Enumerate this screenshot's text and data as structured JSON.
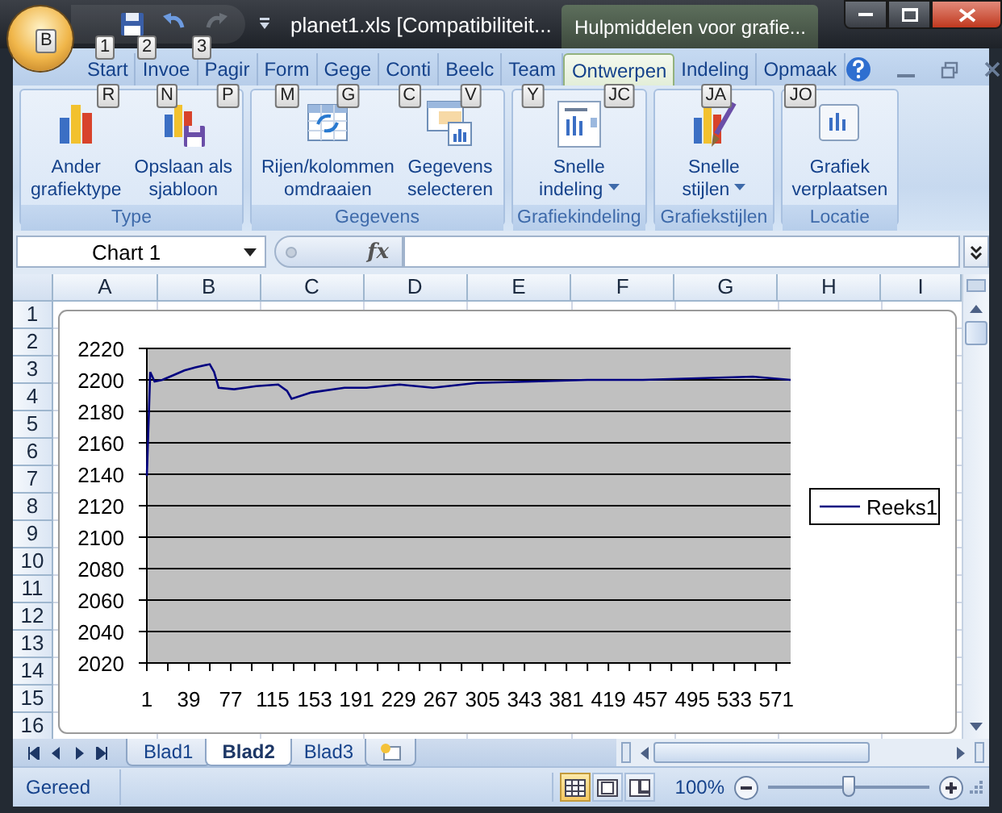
{
  "window": {
    "title": "planet1.xls  [Compatibiliteit...",
    "context_title": "Hulpmiddelen voor grafie..."
  },
  "office_button": {
    "keytip": "B"
  },
  "quick_access": [
    {
      "keytip": "1",
      "disabled": false
    },
    {
      "keytip": "2",
      "disabled": false
    },
    {
      "keytip": "3",
      "disabled": true
    }
  ],
  "ribbon_tabs": [
    {
      "label": "Start",
      "keytip": "R",
      "selected": false
    },
    {
      "label": "Invoe",
      "keytip": "N",
      "selected": false
    },
    {
      "label": "Pagir",
      "keytip": "P",
      "selected": false
    },
    {
      "label": "Form",
      "keytip": "M",
      "selected": false
    },
    {
      "label": "Gege",
      "keytip": "G",
      "selected": false
    },
    {
      "label": "Conti",
      "keytip": "C",
      "selected": false
    },
    {
      "label": "Beelc",
      "keytip": "V",
      "selected": false
    },
    {
      "label": "Team",
      "keytip": "Y",
      "selected": false
    },
    {
      "label": "Ontwerpen",
      "keytip": "JC",
      "selected": true
    },
    {
      "label": "Indeling",
      "keytip": "JA",
      "selected": false
    },
    {
      "label": "Opmaak",
      "keytip": "JO",
      "selected": false
    }
  ],
  "ribbon_groups": [
    {
      "label": "Type",
      "buttons": [
        {
          "lines": [
            "Ander",
            "grafiektype"
          ],
          "dropdown": false
        },
        {
          "lines": [
            "Opslaan als",
            "sjabloon"
          ],
          "dropdown": false
        }
      ]
    },
    {
      "label": "Gegevens",
      "buttons": [
        {
          "lines": [
            "Rijen/kolommen",
            "omdraaien"
          ],
          "dropdown": false
        },
        {
          "lines": [
            "Gegevens",
            "selecteren"
          ],
          "dropdown": false
        }
      ]
    },
    {
      "label": "Grafiekindeling",
      "buttons": [
        {
          "lines": [
            "Snelle",
            "indeling"
          ],
          "dropdown": true
        }
      ]
    },
    {
      "label": "Grafiekstijlen",
      "buttons": [
        {
          "lines": [
            "Snelle",
            "stijlen"
          ],
          "dropdown": true
        }
      ]
    },
    {
      "label": "Locatie",
      "buttons": [
        {
          "lines": [
            "Grafiek",
            "verplaatsen"
          ],
          "dropdown": false
        }
      ]
    }
  ],
  "formula_bar": {
    "name_box": "Chart 1",
    "function_label": "fx"
  },
  "sheet": {
    "columns": [
      "A",
      "B",
      "C",
      "D",
      "E",
      "F",
      "G",
      "H",
      "I"
    ],
    "rows": [
      "1",
      "2",
      "3",
      "4",
      "5",
      "6",
      "7",
      "8",
      "9",
      "10",
      "11",
      "12",
      "13",
      "14",
      "15",
      "16"
    ]
  },
  "chart": {
    "chart_data": {
      "type": "line",
      "x": [
        1,
        4,
        8,
        15,
        25,
        35,
        45,
        58,
        62,
        66,
        80,
        100,
        120,
        128,
        132,
        150,
        180,
        200,
        230,
        260,
        300,
        350,
        400,
        450,
        500,
        550,
        584
      ],
      "series": [
        {
          "name": "Reeks1",
          "color": "#000080",
          "values": [
            2139,
            2205,
            2199,
            2200,
            2203,
            2206,
            2208,
            2210,
            2205,
            2195,
            2194,
            2196,
            2197,
            2193,
            2188,
            2192,
            2195,
            2195,
            2197,
            2195,
            2198,
            2199,
            2200,
            2200,
            2201,
            2202,
            2200
          ]
        }
      ],
      "xlim": [
        1,
        584
      ],
      "ylim": [
        2020,
        2220
      ],
      "xticks": [
        1,
        39,
        77,
        115,
        153,
        191,
        229,
        267,
        305,
        343,
        381,
        419,
        457,
        495,
        533,
        571
      ],
      "yticks": [
        2020,
        2040,
        2060,
        2080,
        2100,
        2120,
        2140,
        2160,
        2180,
        2200,
        2220
      ],
      "grid": true
    }
  },
  "sheet_tabs": [
    {
      "label": "Blad1",
      "selected": false
    },
    {
      "label": "Blad2",
      "selected": true
    },
    {
      "label": "Blad3",
      "selected": false
    }
  ],
  "status_bar": {
    "text": "Gereed",
    "view_buttons": [
      {
        "selected": true
      },
      {
        "selected": false
      },
      {
        "selected": false
      }
    ],
    "zoom": "100%",
    "zoom_slider": {
      "level": 0.5
    }
  }
}
